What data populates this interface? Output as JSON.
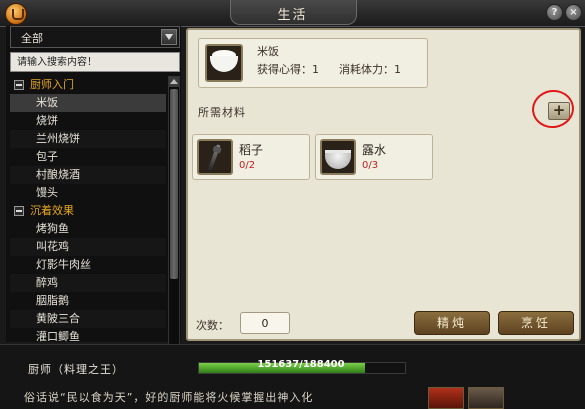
{
  "window": {
    "title": "生活"
  },
  "titlebar": {
    "help_label": "?",
    "close_label": "×"
  },
  "left": {
    "category_value": "全部",
    "search_placeholder": "请输入搜索内容！",
    "groups": [
      {
        "label": "厨师入门",
        "items": [
          "米饭",
          "烧饼",
          "兰州烧饼",
          "包子",
          "村酿烧酒",
          "馒头"
        ]
      },
      {
        "label": "沉着效果",
        "items": [
          "烤狗鱼",
          "叫花鸡",
          "灯影牛肉丝",
          "醉鸡",
          "胭脂鹅",
          "黄陂三合",
          "灌口鲫鱼"
        ]
      }
    ],
    "selected_item": "米饭"
  },
  "recipe": {
    "name": "米饭",
    "gain_label": "获得心得：1",
    "cost_label": "消耗体力：1"
  },
  "materials": {
    "section_label": "所需材料",
    "add_label": "+",
    "items": [
      {
        "name": "稻子",
        "count": "0/2",
        "icon": "rice-stalk-icon"
      },
      {
        "name": "露水",
        "count": "0/3",
        "icon": "water-bowl-icon"
      }
    ]
  },
  "craft": {
    "count_label": "次数：",
    "count_value": "0",
    "refine_label": "精炖",
    "cook_label": "烹饪"
  },
  "bottom": {
    "skill_label": "厨师（料理之王）",
    "progress_text": "151637/188400",
    "progress_value": 151637,
    "progress_max": 188400,
    "tip_text": "俗话说“民以食为天”，好的厨师能将火候掌握出神入化"
  },
  "colors": {
    "accent_group": "#e8a820",
    "progress": "#4aa82a",
    "annotation_circle": "#e01818",
    "count_red": "#c02020"
  }
}
